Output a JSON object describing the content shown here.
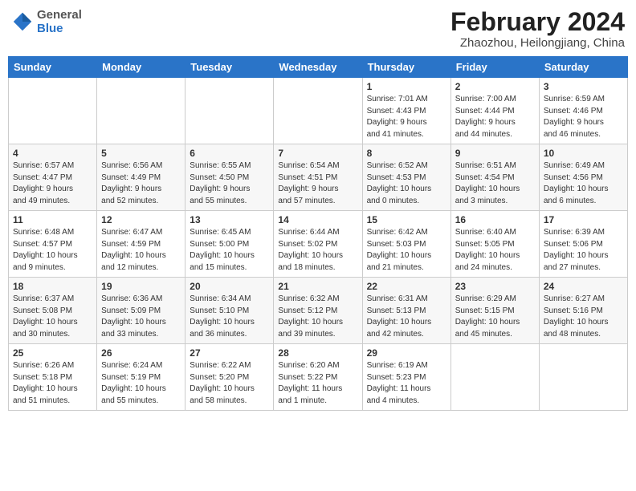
{
  "header": {
    "logo_general": "General",
    "logo_blue": "Blue",
    "month_title": "February 2024",
    "subtitle": "Zhaozhou, Heilongjiang, China"
  },
  "weekdays": [
    "Sunday",
    "Monday",
    "Tuesday",
    "Wednesday",
    "Thursday",
    "Friday",
    "Saturday"
  ],
  "weeks": [
    [
      {
        "day": "",
        "info": ""
      },
      {
        "day": "",
        "info": ""
      },
      {
        "day": "",
        "info": ""
      },
      {
        "day": "",
        "info": ""
      },
      {
        "day": "1",
        "info": "Sunrise: 7:01 AM\nSunset: 4:43 PM\nDaylight: 9 hours\nand 41 minutes."
      },
      {
        "day": "2",
        "info": "Sunrise: 7:00 AM\nSunset: 4:44 PM\nDaylight: 9 hours\nand 44 minutes."
      },
      {
        "day": "3",
        "info": "Sunrise: 6:59 AM\nSunset: 4:46 PM\nDaylight: 9 hours\nand 46 minutes."
      }
    ],
    [
      {
        "day": "4",
        "info": "Sunrise: 6:57 AM\nSunset: 4:47 PM\nDaylight: 9 hours\nand 49 minutes."
      },
      {
        "day": "5",
        "info": "Sunrise: 6:56 AM\nSunset: 4:49 PM\nDaylight: 9 hours\nand 52 minutes."
      },
      {
        "day": "6",
        "info": "Sunrise: 6:55 AM\nSunset: 4:50 PM\nDaylight: 9 hours\nand 55 minutes."
      },
      {
        "day": "7",
        "info": "Sunrise: 6:54 AM\nSunset: 4:51 PM\nDaylight: 9 hours\nand 57 minutes."
      },
      {
        "day": "8",
        "info": "Sunrise: 6:52 AM\nSunset: 4:53 PM\nDaylight: 10 hours\nand 0 minutes."
      },
      {
        "day": "9",
        "info": "Sunrise: 6:51 AM\nSunset: 4:54 PM\nDaylight: 10 hours\nand 3 minutes."
      },
      {
        "day": "10",
        "info": "Sunrise: 6:49 AM\nSunset: 4:56 PM\nDaylight: 10 hours\nand 6 minutes."
      }
    ],
    [
      {
        "day": "11",
        "info": "Sunrise: 6:48 AM\nSunset: 4:57 PM\nDaylight: 10 hours\nand 9 minutes."
      },
      {
        "day": "12",
        "info": "Sunrise: 6:47 AM\nSunset: 4:59 PM\nDaylight: 10 hours\nand 12 minutes."
      },
      {
        "day": "13",
        "info": "Sunrise: 6:45 AM\nSunset: 5:00 PM\nDaylight: 10 hours\nand 15 minutes."
      },
      {
        "day": "14",
        "info": "Sunrise: 6:44 AM\nSunset: 5:02 PM\nDaylight: 10 hours\nand 18 minutes."
      },
      {
        "day": "15",
        "info": "Sunrise: 6:42 AM\nSunset: 5:03 PM\nDaylight: 10 hours\nand 21 minutes."
      },
      {
        "day": "16",
        "info": "Sunrise: 6:40 AM\nSunset: 5:05 PM\nDaylight: 10 hours\nand 24 minutes."
      },
      {
        "day": "17",
        "info": "Sunrise: 6:39 AM\nSunset: 5:06 PM\nDaylight: 10 hours\nand 27 minutes."
      }
    ],
    [
      {
        "day": "18",
        "info": "Sunrise: 6:37 AM\nSunset: 5:08 PM\nDaylight: 10 hours\nand 30 minutes."
      },
      {
        "day": "19",
        "info": "Sunrise: 6:36 AM\nSunset: 5:09 PM\nDaylight: 10 hours\nand 33 minutes."
      },
      {
        "day": "20",
        "info": "Sunrise: 6:34 AM\nSunset: 5:10 PM\nDaylight: 10 hours\nand 36 minutes."
      },
      {
        "day": "21",
        "info": "Sunrise: 6:32 AM\nSunset: 5:12 PM\nDaylight: 10 hours\nand 39 minutes."
      },
      {
        "day": "22",
        "info": "Sunrise: 6:31 AM\nSunset: 5:13 PM\nDaylight: 10 hours\nand 42 minutes."
      },
      {
        "day": "23",
        "info": "Sunrise: 6:29 AM\nSunset: 5:15 PM\nDaylight: 10 hours\nand 45 minutes."
      },
      {
        "day": "24",
        "info": "Sunrise: 6:27 AM\nSunset: 5:16 PM\nDaylight: 10 hours\nand 48 minutes."
      }
    ],
    [
      {
        "day": "25",
        "info": "Sunrise: 6:26 AM\nSunset: 5:18 PM\nDaylight: 10 hours\nand 51 minutes."
      },
      {
        "day": "26",
        "info": "Sunrise: 6:24 AM\nSunset: 5:19 PM\nDaylight: 10 hours\nand 55 minutes."
      },
      {
        "day": "27",
        "info": "Sunrise: 6:22 AM\nSunset: 5:20 PM\nDaylight: 10 hours\nand 58 minutes."
      },
      {
        "day": "28",
        "info": "Sunrise: 6:20 AM\nSunset: 5:22 PM\nDaylight: 11 hours\nand 1 minute."
      },
      {
        "day": "29",
        "info": "Sunrise: 6:19 AM\nSunset: 5:23 PM\nDaylight: 11 hours\nand 4 minutes."
      },
      {
        "day": "",
        "info": ""
      },
      {
        "day": "",
        "info": ""
      }
    ]
  ]
}
